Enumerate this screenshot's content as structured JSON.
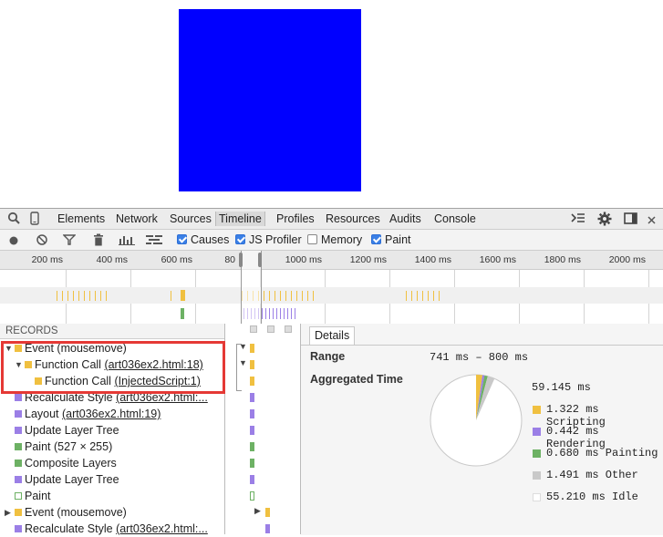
{
  "colors": {
    "blue_box": "#0000ff",
    "scripting": "#f0c040",
    "rendering": "#9b7fe6",
    "painting": "#6db164",
    "other": "#c9c9c9",
    "idle": "#ffffff",
    "highlight": "#e53935"
  },
  "tabs": [
    {
      "label": "Elements"
    },
    {
      "label": "Network"
    },
    {
      "label": "Sources"
    },
    {
      "label": "Timeline"
    },
    {
      "label": "Profiles"
    },
    {
      "label": "Resources"
    },
    {
      "label": "Audits"
    },
    {
      "label": "Console"
    }
  ],
  "toolbar": {
    "checkboxes": [
      {
        "label": "Causes",
        "checked": true
      },
      {
        "label": "JS Profiler",
        "checked": true
      },
      {
        "label": "Memory",
        "checked": false
      },
      {
        "label": "Paint",
        "checked": true
      }
    ]
  },
  "ruler": {
    "ticks": [
      "200 ms",
      "400 ms",
      "600 ms",
      "80",
      "1000 ms",
      "1200 ms",
      "1400 ms",
      "1600 ms",
      "1800 ms",
      "2000 ms"
    ]
  },
  "records": {
    "header": "RECORDS",
    "rows": [
      {
        "text": "Event (mousemove)",
        "link": "",
        "indent": 0,
        "arrow": "▼",
        "color": "#f0c040"
      },
      {
        "text": "Function Call ",
        "link": "(art036ex2.html:18)",
        "indent": 1,
        "arrow": "▼",
        "color": "#f0c040"
      },
      {
        "text": "Function Call ",
        "link": "(InjectedScript:1)",
        "indent": 2,
        "arrow": "",
        "color": "#f0c040"
      },
      {
        "text": "Recalculate Style ",
        "link": "(art036ex2.html:...",
        "indent": 0,
        "arrow": "",
        "color": "#9b7fe6"
      },
      {
        "text": "Layout ",
        "link": "(art036ex2.html:19)",
        "indent": 0,
        "arrow": "",
        "color": "#9b7fe6"
      },
      {
        "text": "Update Layer Tree",
        "link": "",
        "indent": 0,
        "arrow": "",
        "color": "#9b7fe6"
      },
      {
        "text": "Paint (527 × 255)",
        "link": "",
        "indent": 0,
        "arrow": "",
        "color": "#6db164"
      },
      {
        "text": "Composite Layers",
        "link": "",
        "indent": 0,
        "arrow": "",
        "color": "#6db164"
      },
      {
        "text": "Update Layer Tree",
        "link": "",
        "indent": 0,
        "arrow": "",
        "color": "#9b7fe6"
      },
      {
        "text": "Paint",
        "link": "",
        "indent": 0,
        "arrow": "",
        "color": "outline"
      },
      {
        "text": "Event (mousemove)",
        "link": "",
        "indent": 0,
        "arrow": "▶",
        "color": "#f0c040"
      },
      {
        "text": "Recalculate Style ",
        "link": "(art036ex2.html:...",
        "indent": 0,
        "arrow": "",
        "color": "#9b7fe6"
      }
    ]
  },
  "details": {
    "tab_label": "Details",
    "range_label": "Range",
    "range_value": "741 ms – 800 ms",
    "aggregated_label": "Aggregated Time",
    "total": "59.145 ms",
    "breakdown": [
      {
        "value": "1.322 ms",
        "label": "Scripting",
        "ms": 1.322
      },
      {
        "value": "0.442 ms",
        "label": "Rendering",
        "ms": 0.442
      },
      {
        "value": "0.680 ms",
        "label": "Painting",
        "ms": 0.68
      },
      {
        "value": "1.491 ms",
        "label": "Other",
        "ms": 1.491
      },
      {
        "value": "55.210 ms",
        "label": "Idle",
        "ms": 55.21
      }
    ]
  }
}
